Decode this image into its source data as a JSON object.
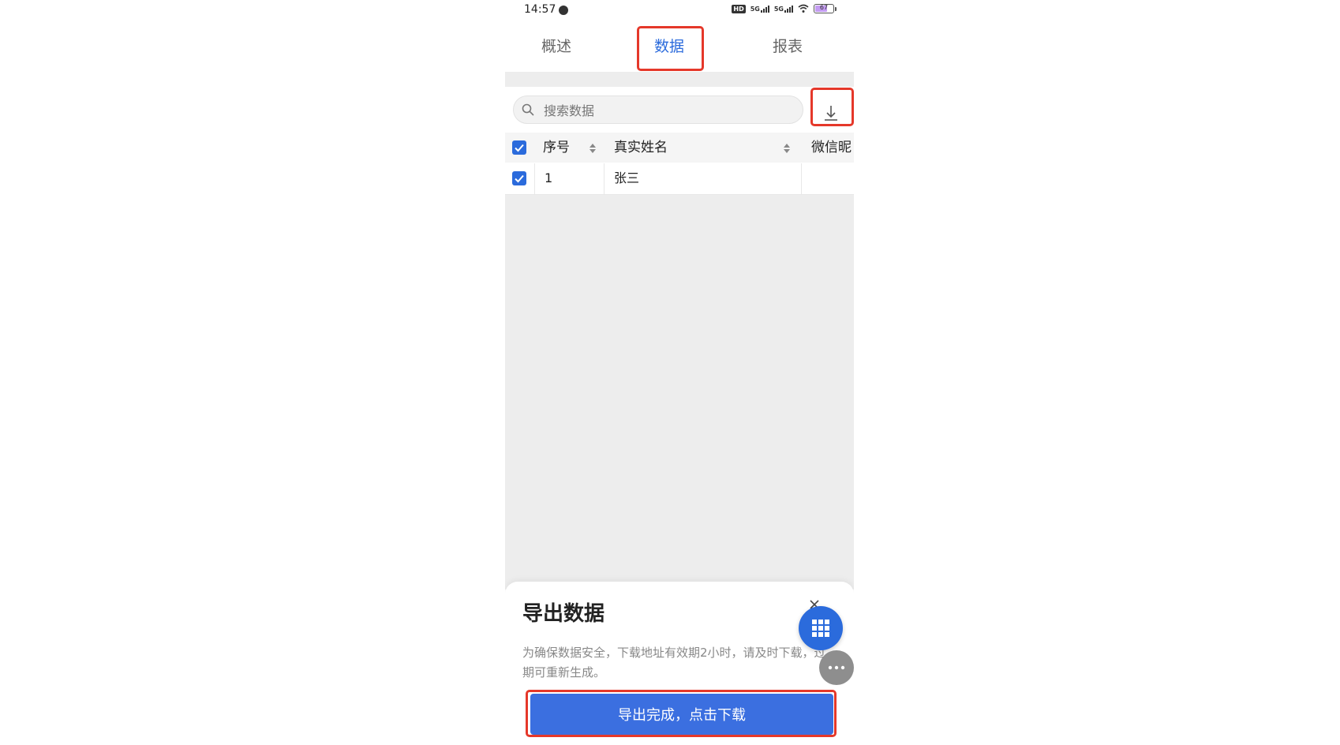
{
  "status_bar": {
    "time": "14:57",
    "hd_label": "HD",
    "signal_1": "5G",
    "signal_2": "5G",
    "battery": "67"
  },
  "tabs": [
    {
      "label": "概述",
      "active": false
    },
    {
      "label": "数据",
      "active": true
    },
    {
      "label": "报表",
      "active": false
    }
  ],
  "search": {
    "placeholder": "搜索数据"
  },
  "table": {
    "columns": [
      "序号",
      "真实姓名",
      "微信昵"
    ],
    "rows": [
      {
        "index": "1",
        "name": "张三",
        "nickname": ""
      }
    ]
  },
  "export_sheet": {
    "title": "导出数据",
    "description": "为确保数据安全，下载地址有效期2小时，请及时下载，过期可重新生成。",
    "button_label": "导出完成，点击下载"
  },
  "colors": {
    "accent": "#2b6bdc",
    "highlight": "#e5382a",
    "button": "#3b6fe0"
  }
}
